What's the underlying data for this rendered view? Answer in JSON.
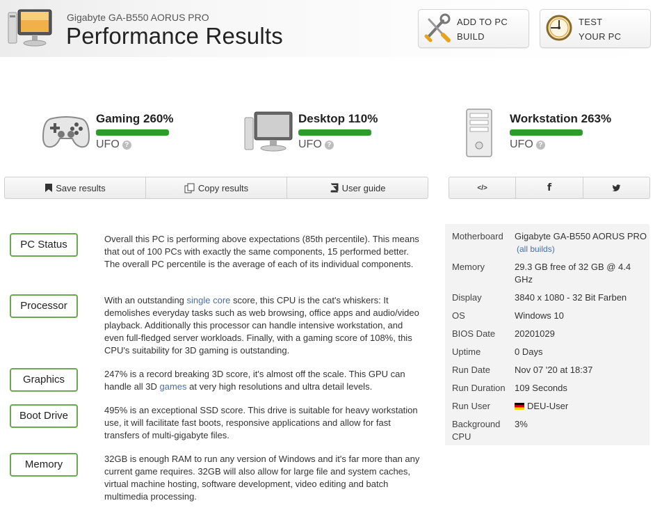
{
  "header": {
    "subtitle": "Gigabyte GA-B550 AORUS PRO",
    "title": "Performance Results",
    "add_build": {
      "line1": "ADD TO PC",
      "line2": "BUILD"
    },
    "test_pc": {
      "line1": "TEST",
      "line2": "YOUR PC"
    }
  },
  "scores": [
    {
      "label": "Gaming 260%",
      "tier": "UFO",
      "fill_fraction": 1.0,
      "icon": "gamepad-icon"
    },
    {
      "label": "Desktop 110%",
      "tier": "UFO",
      "fill_fraction": 1.0,
      "icon": "monitor-icon"
    },
    {
      "label": "Workstation 263%",
      "tier": "UFO",
      "fill_fraction": 1.0,
      "icon": "server-icon"
    }
  ],
  "qmark": "?",
  "actions": {
    "save": "Save results",
    "copy": "Copy results",
    "guide": "User guide"
  },
  "share": {
    "embed": "</>",
    "facebook": "f",
    "twitter": "t"
  },
  "categories": [
    {
      "name": "PC Status",
      "text": "Overall this PC is performing above expectations (85th percentile). This means that out of 100 PCs with exactly the same components, 15 performed better. The overall PC percentile is the average of each of its individual components."
    },
    {
      "name": "Processor",
      "pre": "With an outstanding ",
      "link": "single core",
      "post": " score, this CPU is the cat's whiskers: It demolishes everyday tasks such as web browsing, office apps and audio/video playback. Additionally this processor can handle intensive workstation, and even full-fledged server workloads. Finally, with a gaming score of 108%, this CPU's suitability for 3D gaming is outstanding."
    },
    {
      "name": "Graphics",
      "pre": "247% is a record breaking 3D score, it's almost off the scale. This GPU can handle all 3D ",
      "link": "games",
      "post": " at very high resolutions and ultra detail levels."
    },
    {
      "name": "Boot Drive",
      "text": "495% is an exceptional SSD score. This drive is suitable for heavy workstation use, it will facilitate fast boots, responsive applications and allow for fast transfers of multi-gigabyte files."
    },
    {
      "name": "Memory",
      "text": "32GB is enough RAM to run any version of Windows and it's far more than any current game requires. 32GB will also allow for large file and system caches, virtual machine hosting, software development, video editing and batch multimedia processing."
    }
  ],
  "specs": {
    "motherboard": {
      "key": "Motherboard",
      "value": "Gigabyte GA-B550 AORUS PRO",
      "link": "(all builds)"
    },
    "memory": {
      "key": "Memory",
      "value": "29.3 GB free of 32 GB @ 4.4 GHz"
    },
    "display": {
      "key": "Display",
      "value": "3840 x 1080 - 32 Bit Farben"
    },
    "os": {
      "key": "OS",
      "value": "Windows 10"
    },
    "bios": {
      "key": "BIOS Date",
      "value": "20201029"
    },
    "uptime": {
      "key": "Uptime",
      "value": "0 Days"
    },
    "run_date": {
      "key": "Run Date",
      "value": "Nov 07 '20 at 18:37"
    },
    "run_duration": {
      "key": "Run Duration",
      "value": "109 Seconds"
    },
    "run_user": {
      "key": "Run User",
      "value": "DEU-User"
    },
    "background_cpu": {
      "key": "Background CPU",
      "value": "3%"
    }
  },
  "colors": {
    "accent_green": "#2e9b2e",
    "category_border": "#6aa84f",
    "link": "#4a6fa5"
  }
}
